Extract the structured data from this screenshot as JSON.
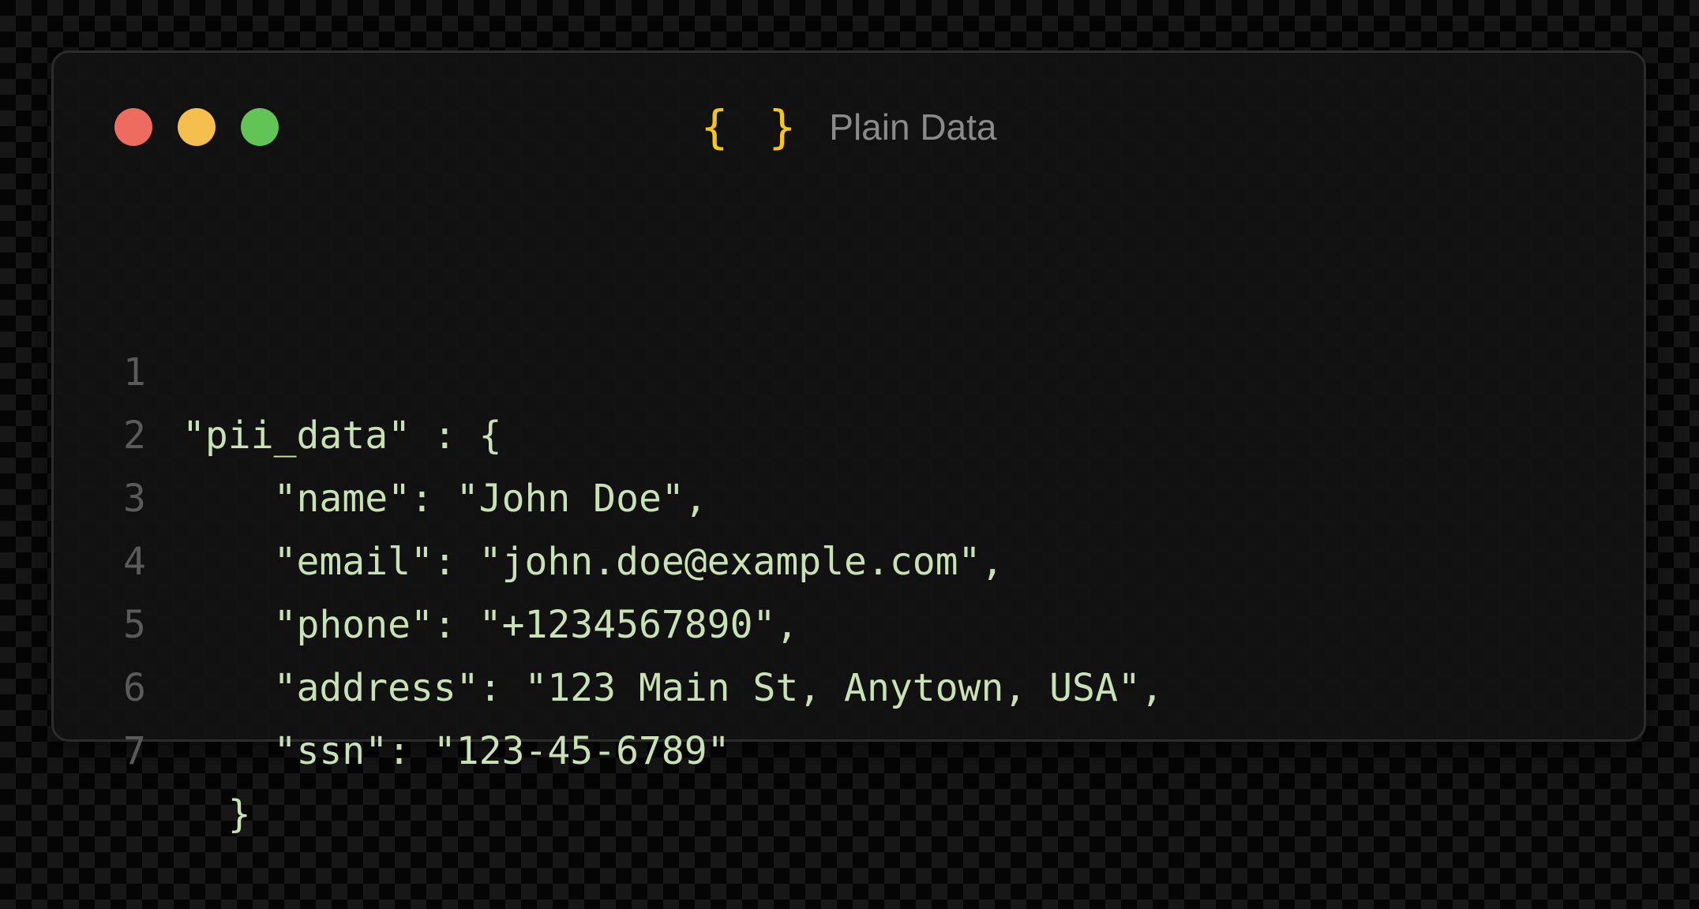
{
  "window": {
    "title": "Plain Data",
    "title_icon": "{ }",
    "controls": [
      "close-button",
      "minimize-button",
      "maximize-button"
    ]
  },
  "code": {
    "lines": [
      {
        "number": "1",
        "text": "\"pii_data\" : {"
      },
      {
        "number": "2",
        "text": "    \"name\": \"John Doe\","
      },
      {
        "number": "3",
        "text": "    \"email\": \"john.doe@example.com\","
      },
      {
        "number": "4",
        "text": "    \"phone\": \"+1234567890\","
      },
      {
        "number": "5",
        "text": "    \"address\": \"123 Main St, Anytown, USA\","
      },
      {
        "number": "6",
        "text": "    \"ssn\": \"123-45-6789\""
      },
      {
        "number": "7",
        "text": "  }"
      }
    ]
  },
  "colors": {
    "close": "#ee6b60",
    "minimize": "#f5bf4f",
    "maximize": "#61c454",
    "icon": "#f5c518",
    "string": "#c9e2b3",
    "line_number": "#5a5a5a"
  }
}
